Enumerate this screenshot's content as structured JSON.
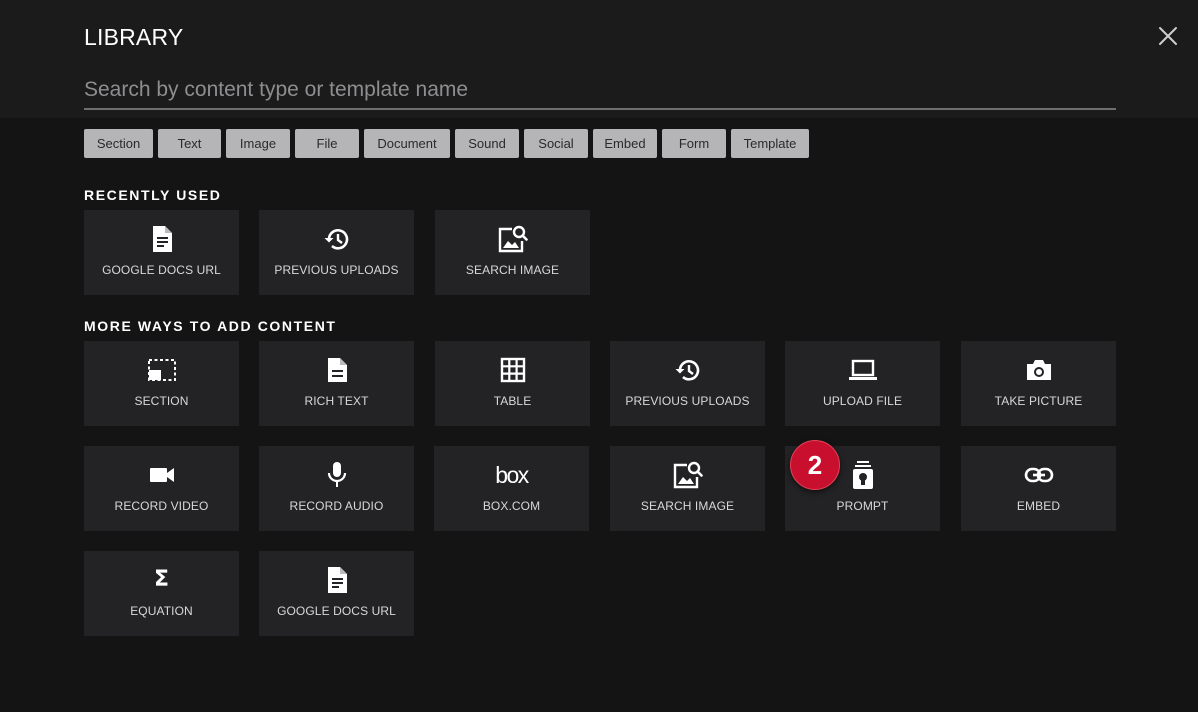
{
  "header": {
    "title": "LIBRARY",
    "search_placeholder": "Search by content type or template name",
    "search_value": ""
  },
  "filters": [
    "Section",
    "Text",
    "Image",
    "File",
    "Document",
    "Sound",
    "Social",
    "Embed",
    "Form",
    "Template"
  ],
  "recent": {
    "heading": "RECENTLY USED",
    "items": [
      {
        "label": "GOOGLE DOCS URL",
        "icon": "document-icon"
      },
      {
        "label": "PREVIOUS UPLOADS",
        "icon": "history-icon"
      },
      {
        "label": "SEARCH IMAGE",
        "icon": "image-search-icon"
      }
    ]
  },
  "more": {
    "heading": "MORE WAYS TO ADD CONTENT",
    "items": [
      {
        "label": "SECTION",
        "icon": "section-icon"
      },
      {
        "label": "RICH TEXT",
        "icon": "rich-text-icon"
      },
      {
        "label": "TABLE",
        "icon": "table-icon"
      },
      {
        "label": "PREVIOUS UPLOADS",
        "icon": "history-icon"
      },
      {
        "label": "UPLOAD FILE",
        "icon": "laptop-icon"
      },
      {
        "label": "TAKE PICTURE",
        "icon": "camera-icon"
      },
      {
        "label": "RECORD VIDEO",
        "icon": "video-camera-icon"
      },
      {
        "label": "RECORD AUDIO",
        "icon": "microphone-icon"
      },
      {
        "label": "BOX.COM",
        "icon": "box-logo",
        "logo_text": "box"
      },
      {
        "label": "SEARCH IMAGE",
        "icon": "image-search-icon"
      },
      {
        "label": "PROMPT",
        "icon": "prompt-icon"
      },
      {
        "label": "EMBED",
        "icon": "link-icon"
      },
      {
        "label": "EQUATION",
        "icon": "sigma-icon",
        "glyph": "Σ"
      },
      {
        "label": "GOOGLE DOCS URL",
        "icon": "document-icon"
      }
    ]
  },
  "step_badge": "2",
  "colors": {
    "background": "#141414",
    "header_band": "#1b1b1c",
    "tile": "#232325",
    "chip": "#b5b5b7",
    "badge": "#c8102e"
  }
}
